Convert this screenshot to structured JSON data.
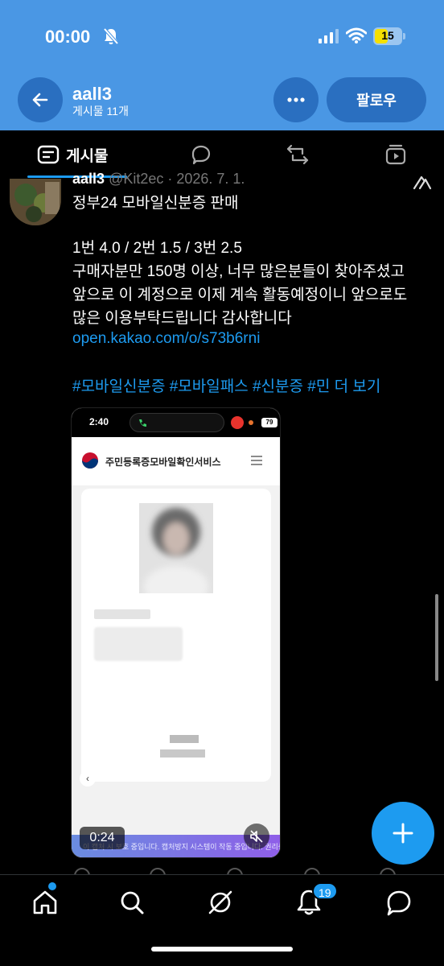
{
  "status_bar": {
    "time": "00:00",
    "battery": "15"
  },
  "header": {
    "name": "aall3",
    "post_count": "게시물 11개",
    "follow_label": "팔로우"
  },
  "tabs": {
    "posts_label": "게시물"
  },
  "post": {
    "author": "aall3",
    "handle": "@Kit2ec · 2026. 7. 1.",
    "lines": [
      "정부24 모바일신분증 판매",
      "1번 4.0 / 2번 1.5 / 3번 2.5",
      "구매자분만 150명 이상, 너무 많은분들이 찾아주셨고",
      "앞으로 이 계정으로 이제 계속 활동예정이니 앞으로도",
      "많은 이용부탁드립니다 감사합니다"
    ],
    "link": "open.kakao.com/o/s73b6rni",
    "hashtags": "#모바일신분증 #모바일패스 #신분증 #민",
    "more_label": "더 보기"
  },
  "media": {
    "phone_time": "2:40",
    "phone_battery": "79",
    "app_title": "주민등록증모바일확인서비스",
    "footer_text": "이 캡처 시 보호 중입니다. 캡처방지 시스템이 작동 중입니다. 권리를",
    "duration": "0:24"
  },
  "bottom_nav": {
    "notifications_count": "19"
  },
  "colors": {
    "header_blue": "#4a97e4",
    "button_blue": "#2a6fc0",
    "accent": "#1d9bf0",
    "background": "#000000"
  }
}
